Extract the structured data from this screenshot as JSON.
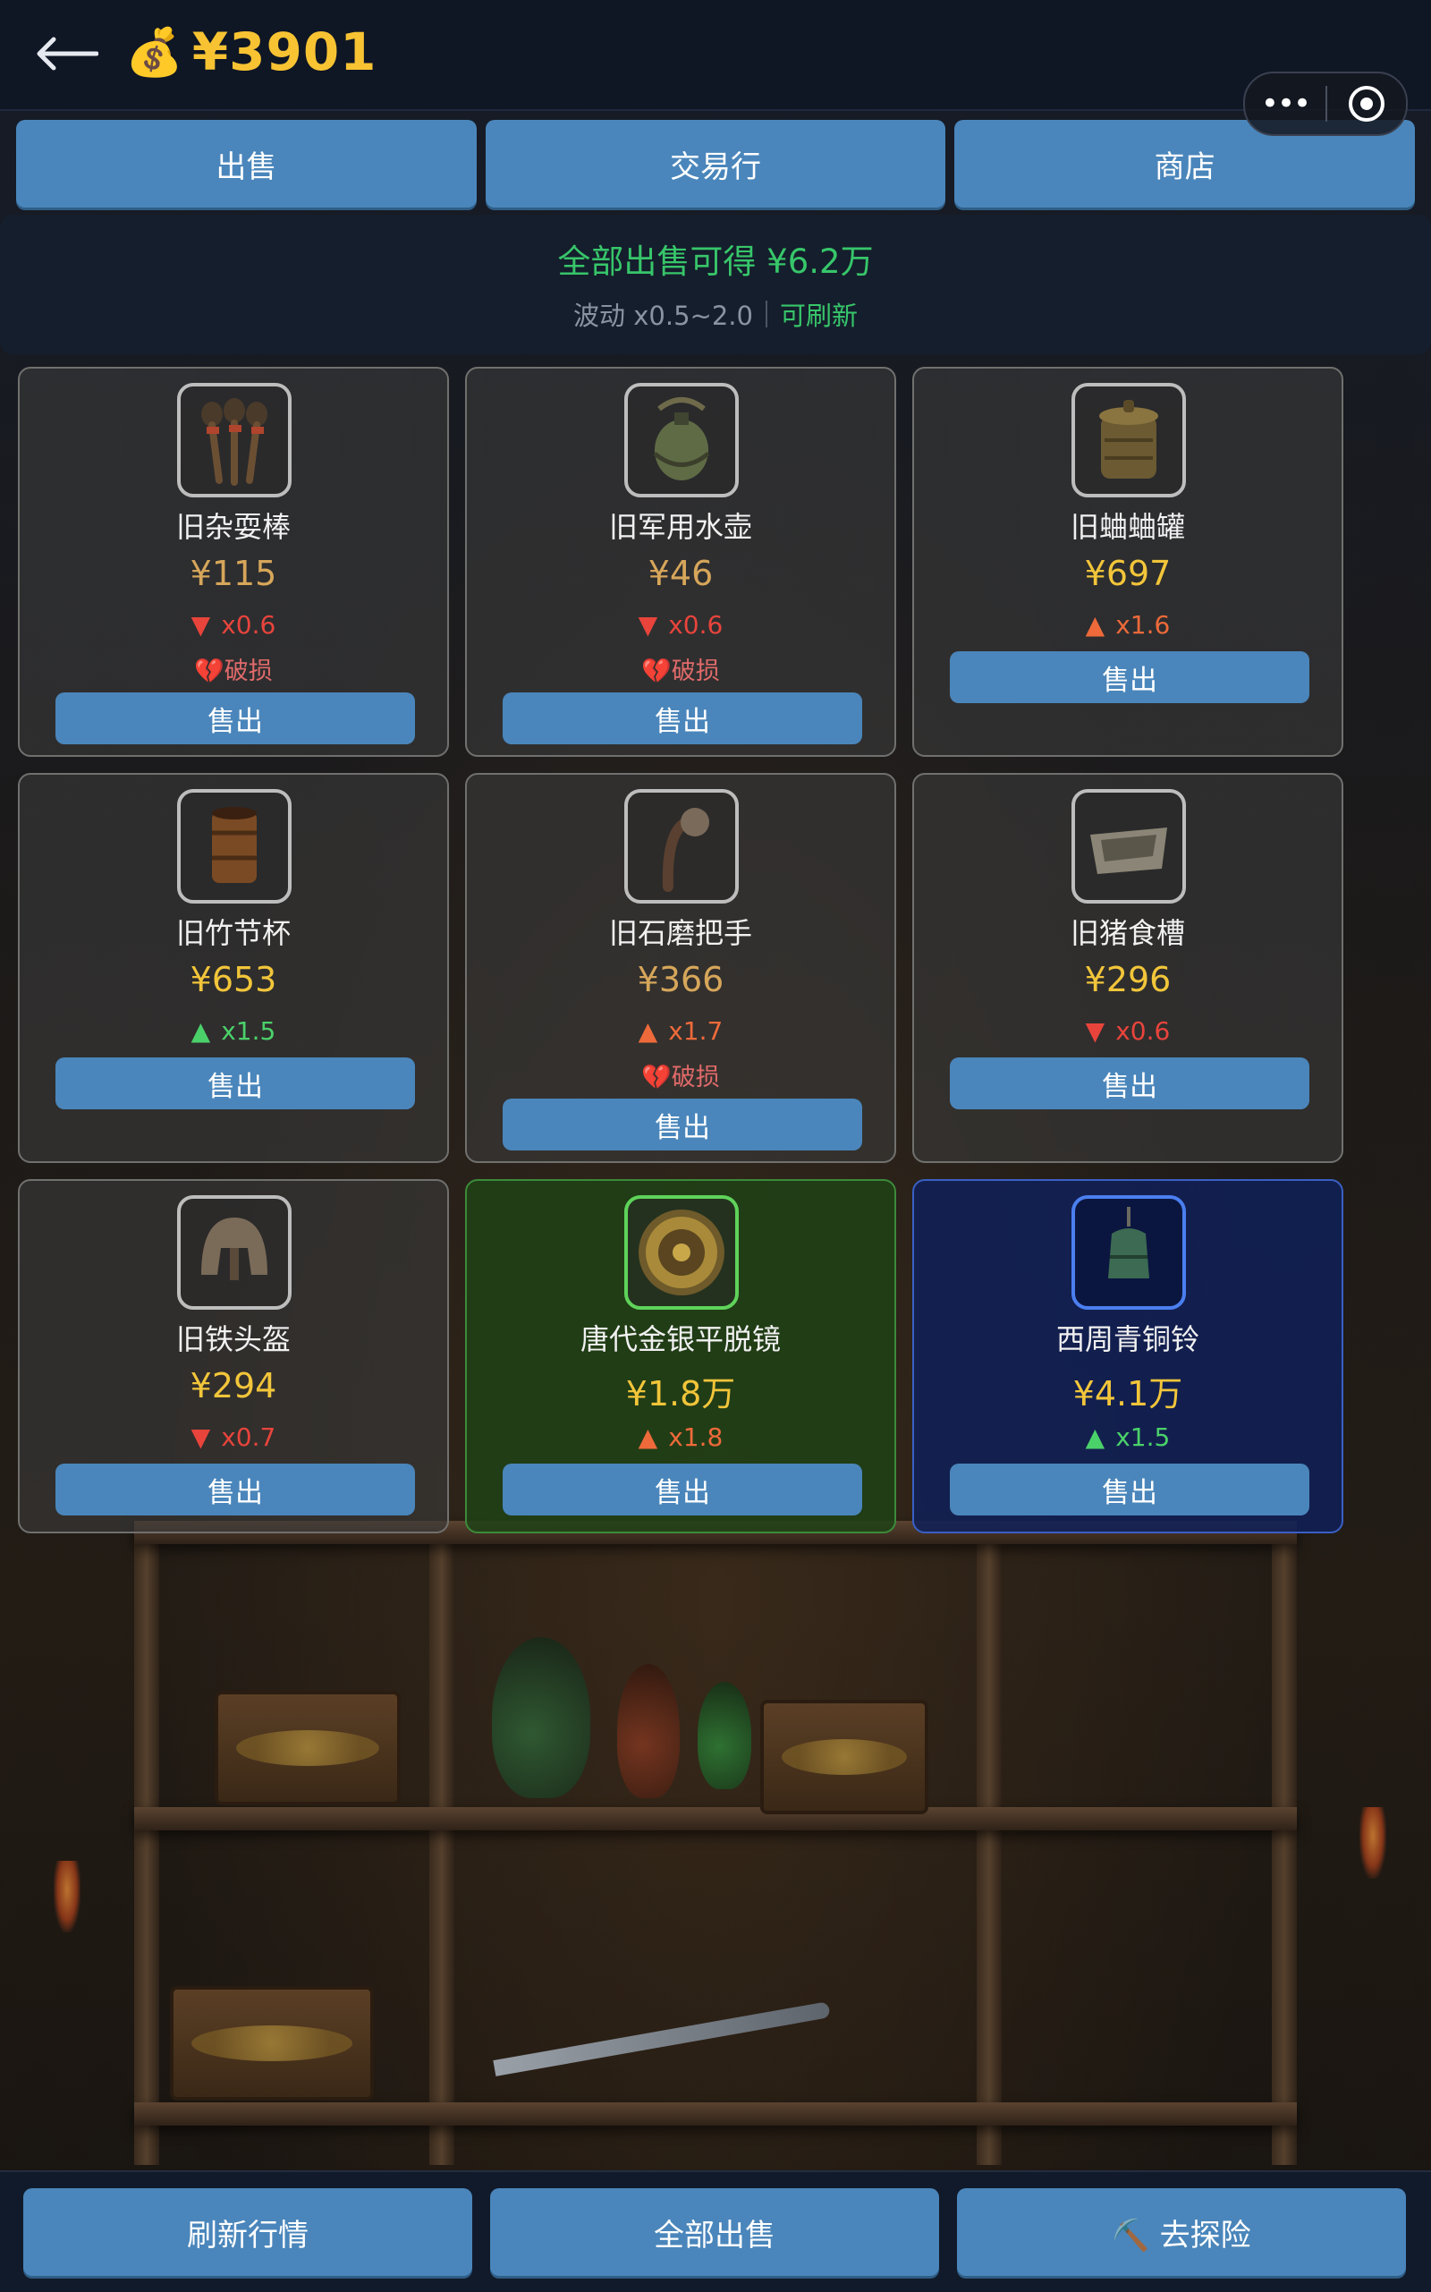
{
  "header": {
    "back_icon": "back-arrow-icon",
    "money_icon": "💰",
    "money": "¥3901"
  },
  "capsule": {
    "more_label": "•••"
  },
  "tabs": [
    {
      "label": "出售"
    },
    {
      "label": "交易行"
    },
    {
      "label": "商店"
    }
  ],
  "summary": {
    "total": "全部出售可得 ¥6.2万",
    "fluctuation": "波动 x0.5~2.0",
    "refresh": "可刷新"
  },
  "items": [
    {
      "name": "旧杂耍棒",
      "price": "¥115",
      "arrow": "▼",
      "mult": "x0.6",
      "damaged": "💔破损",
      "sell": "售出",
      "icon": "juggling-clubs-icon"
    },
    {
      "name": "旧军用水壶",
      "price": "¥46",
      "arrow": "▼",
      "mult": "x0.6",
      "damaged": "💔破损",
      "sell": "售出",
      "icon": "canteen-icon"
    },
    {
      "name": "旧蛐蛐罐",
      "price": "¥697",
      "arrow": "▲",
      "mult": "x1.6",
      "sell": "售出",
      "icon": "cricket-jar-icon"
    },
    {
      "name": "旧竹节杯",
      "price": "¥653",
      "arrow": "▲",
      "mult": "x1.5",
      "sell": "售出",
      "icon": "bamboo-cup-icon"
    },
    {
      "name": "旧石磨把手",
      "price": "¥366",
      "arrow": "▲",
      "mult": "x1.7",
      "damaged": "💔破损",
      "sell": "售出",
      "icon": "millstone-handle-icon"
    },
    {
      "name": "旧猪食槽",
      "price": "¥296",
      "arrow": "▼",
      "mult": "x0.6",
      "sell": "售出",
      "icon": "trough-icon"
    },
    {
      "name": "旧铁头盔",
      "price": "¥294",
      "arrow": "▼",
      "mult": "x0.7",
      "sell": "售出",
      "icon": "helmet-icon"
    },
    {
      "name": "唐代金银平脱镜",
      "price": "¥1.8万",
      "arrow": "▲",
      "mult": "x1.8",
      "sell": "售出",
      "icon": "bronze-mirror-icon"
    },
    {
      "name": "西周青铜铃",
      "price": "¥4.1万",
      "arrow": "▲",
      "mult": "x1.5",
      "sell": "售出",
      "icon": "bronze-bell-icon"
    }
  ],
  "bottom": {
    "refresh": "刷新行情",
    "sell_all": "全部出售",
    "explore": "⛏️ 去探险"
  },
  "colors": {
    "accent": "#4a86bb",
    "gold": "#f2c53a",
    "green": "#37c66a",
    "down": "#e8443c"
  }
}
